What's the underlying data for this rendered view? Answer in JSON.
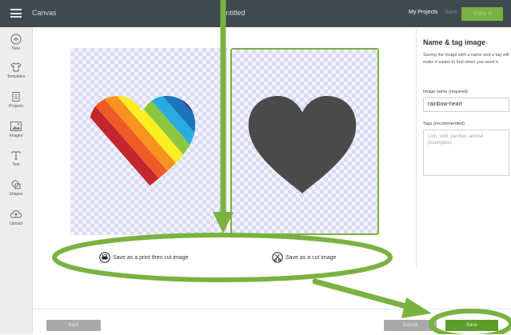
{
  "topbar": {
    "app_name": "Canvas",
    "doc_title": "Untitled",
    "my_projects": "My Projects",
    "save_label": "Save",
    "make_it_label": "Make It"
  },
  "sidebar": {
    "items": [
      {
        "label": "New",
        "icon": "plus-circle-icon"
      },
      {
        "label": "Templates",
        "icon": "shirt-icon"
      },
      {
        "label": "Projects",
        "icon": "projects-icon"
      },
      {
        "label": "Images",
        "icon": "image-icon"
      },
      {
        "label": "Text",
        "icon": "text-icon"
      },
      {
        "label": "Shapes",
        "icon": "shapes-icon"
      },
      {
        "label": "Upload",
        "icon": "upload-icon"
      }
    ]
  },
  "options": {
    "print_then_cut": "Save as a print then cut image",
    "cut": "Save as a cut image"
  },
  "right_panel": {
    "title": "Name & tag image",
    "description": "Saving the image with a name and a tag will make it easier to find when you need it.",
    "name_label": "Image name (required)",
    "name_value": "rainbow-heart",
    "tags_label": "Tags (recommended)",
    "tags_placeholder": "Lion, wild, panther, animal (examples)"
  },
  "footer": {
    "back_label": "Back",
    "cancel_label": "Cancel",
    "save_label": "Save"
  },
  "colors": {
    "accent": "#7ab241",
    "topbar": "#3f4a4f",
    "heart_cut": "#4a4a4a",
    "rainbow": [
      "#c1272d",
      "#f05a28",
      "#f7931e",
      "#fcee21",
      "#8cc63f",
      "#29abe2",
      "#1b75bc",
      "#2e3192"
    ]
  }
}
